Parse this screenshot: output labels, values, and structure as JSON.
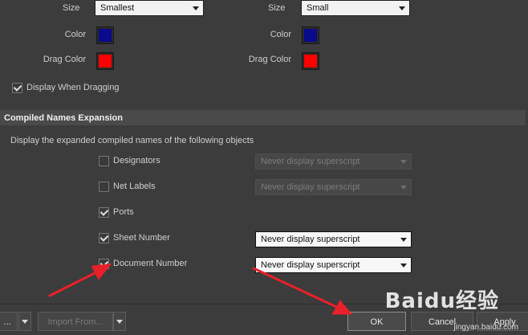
{
  "top": {
    "left": {
      "size_label": "Size",
      "size_value": "Smallest",
      "color_label": "Color",
      "color": "#0a0a8c",
      "drag_label": "Drag Color",
      "drag_color": "#ff0000"
    },
    "right": {
      "size_label": "Size",
      "size_value": "Small",
      "color_label": "Color",
      "color": "#0a0a8c",
      "drag_label": "Drag Color",
      "drag_color": "#ff0000"
    },
    "display_when_dragging": {
      "label": "Display When Dragging",
      "checked": true
    }
  },
  "section": {
    "title": "Compiled Names Expansion",
    "description": "Display the expanded compiled names of the following objects"
  },
  "items": [
    {
      "label": "Designators",
      "checked": false,
      "dropdown": "Never display superscript",
      "dropdown_enabled": false
    },
    {
      "label": "Net Labels",
      "checked": false,
      "dropdown": "Never display superscript",
      "dropdown_enabled": false
    },
    {
      "label": "Ports",
      "checked": true,
      "dropdown": "",
      "dropdown_enabled": false
    },
    {
      "label": "Sheet Number",
      "checked": true,
      "dropdown": "Never display superscript",
      "dropdown_enabled": true
    },
    {
      "label": "Document Number",
      "checked": true,
      "dropdown": "Never display superscript",
      "dropdown_enabled": true
    }
  ],
  "footer": {
    "left_button": "...",
    "import_button": "Import From...",
    "ok": "OK",
    "cancel": "Cancel",
    "apply": "Apply"
  },
  "watermark": {
    "brand": "Baidu经验",
    "url": "jingyan.baidu.com"
  },
  "colors": {
    "annotation_arrow": "#e8202a"
  }
}
